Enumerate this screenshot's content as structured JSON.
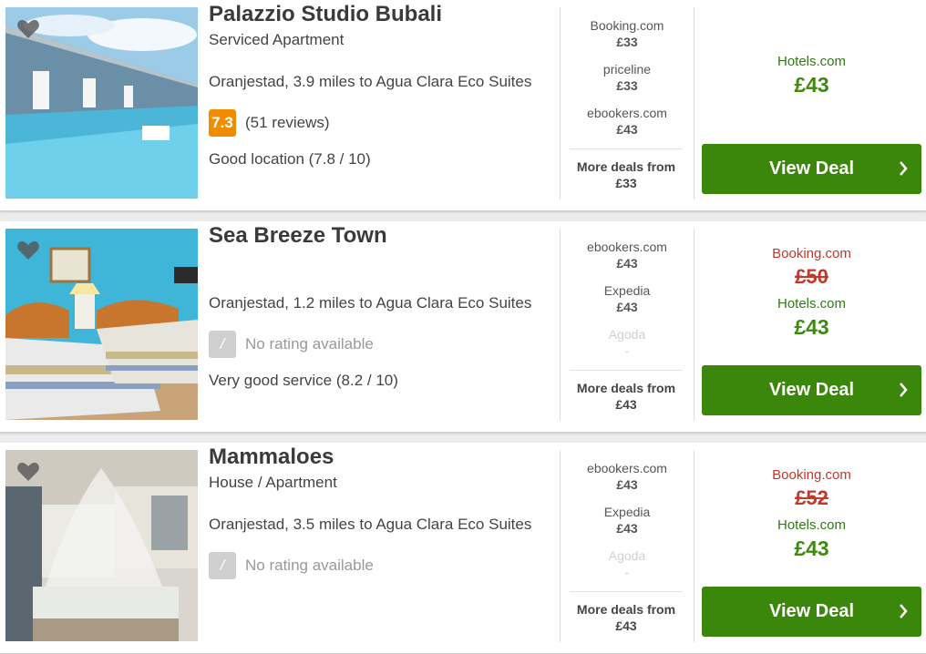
{
  "hotels": [
    {
      "name": "Palazzio Studio Bubali",
      "type": "Serviced Apartment",
      "location": "Oranjestad, 3.9 miles to Agua Clara Eco Suites",
      "score": "7.3",
      "reviews": "(51 reviews)",
      "feature": "Good location (7.8 / 10)",
      "deals": [
        {
          "provider": "Booking.com",
          "price": "£33"
        },
        {
          "provider": "priceline",
          "price": "£33"
        },
        {
          "provider": "ebookers.com",
          "price": "£43"
        }
      ],
      "more_label": "More deals from",
      "more_price": "£33",
      "offer_site": "Hotels.com",
      "offer_price": "£43",
      "button": "View Deal"
    },
    {
      "name": "Sea Breeze Town",
      "type": "",
      "location": "Oranjestad, 1.2 miles to Agua Clara Eco Suites",
      "score": "/",
      "reviews": "No rating available",
      "feature": "Very good service (8.2 / 10)",
      "deals": [
        {
          "provider": "ebookers.com",
          "price": "£43"
        },
        {
          "provider": "Expedia",
          "price": "£43"
        },
        {
          "provider": "Agoda",
          "price": "-"
        }
      ],
      "more_label": "More deals from",
      "more_price": "£43",
      "old_site": "Booking.com",
      "old_price": "£50",
      "offer_site": "Hotels.com",
      "offer_price": "£43",
      "button": "View Deal"
    },
    {
      "name": "Mammaloes",
      "type": "House / Apartment",
      "location": "Oranjestad, 3.5 miles to Agua Clara Eco Suites",
      "score": "/",
      "reviews": "No rating available",
      "feature": "",
      "deals": [
        {
          "provider": "ebookers.com",
          "price": "£43"
        },
        {
          "provider": "Expedia",
          "price": "£43"
        },
        {
          "provider": "Agoda",
          "price": "-"
        }
      ],
      "more_label": "More deals from",
      "more_price": "£43",
      "old_site": "Booking.com",
      "old_price": "£52",
      "offer_site": "Hotels.com",
      "offer_price": "£43",
      "button": "View Deal"
    }
  ],
  "colors": {
    "score_badge": "#f08c00",
    "deal_button": "#3b870b",
    "offer_price": "#3d8a0f",
    "strike_price": "#c0392b"
  },
  "icons": [
    "heart-icon",
    "chevron-right-icon"
  ]
}
